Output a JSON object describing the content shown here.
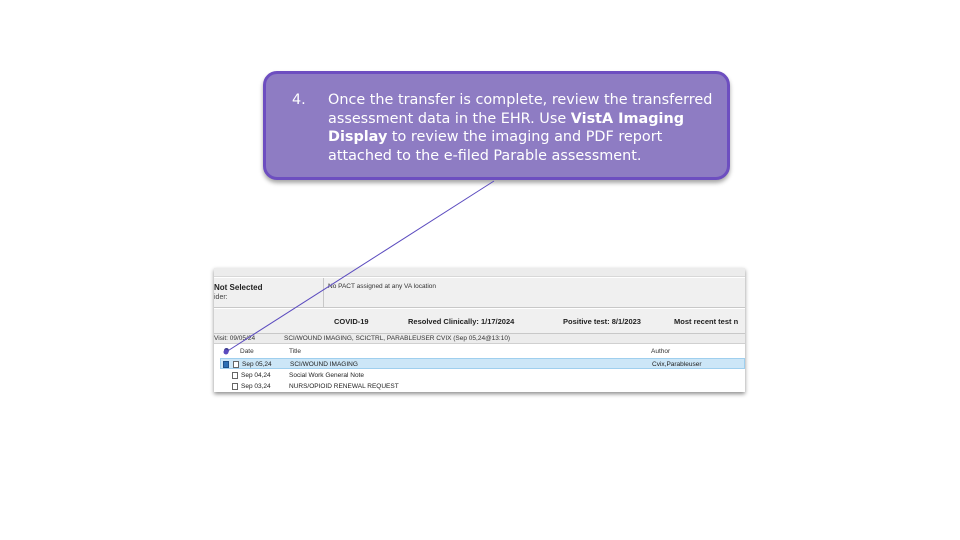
{
  "callout": {
    "number": "4.",
    "text_before": "Once the transfer is complete, review the transferred assessment data in the EHR. Use ",
    "bold": "VistA Imaging Display",
    "text_after": " to review the imaging and PDF report attached to the e-filed Parable assessment."
  },
  "colors": {
    "callout_fill": "#8e7cc3",
    "callout_border": "#6d4ec0",
    "pointer_line": "#5b4bbf",
    "selected_row": "#cce6f7"
  },
  "ehr": {
    "patient": {
      "status": "Not Selected",
      "provider_label": "ider:",
      "pact": "No PACT assigned at any VA location"
    },
    "covid": {
      "label": "COVID-19",
      "resolved": "Resolved Clinically: 1/17/2024",
      "positive": "Positive test: 8/1/2023",
      "recent": "Most recent test n"
    },
    "visit": {
      "label": "Visit: 09/05/24",
      "detail": "SCI/WOUND IMAGING, SCICTRL, PARABLEUSER CVIX  (Sep 05,24@13:10)"
    },
    "columns": {
      "date": "Date",
      "title": "Title",
      "author": "Author"
    },
    "notes": [
      {
        "date": "Sep 05,24",
        "title": "SCI/WOUND IMAGING",
        "author": "Cvix,Parableuser",
        "selected": true
      },
      {
        "date": "Sep 04,24",
        "title": "Social Work General Note",
        "author": "",
        "selected": false
      },
      {
        "date": "Sep 03,24",
        "title": "NURS/OPIOID RENEWAL REQUEST",
        "author": "",
        "selected": false
      }
    ]
  }
}
